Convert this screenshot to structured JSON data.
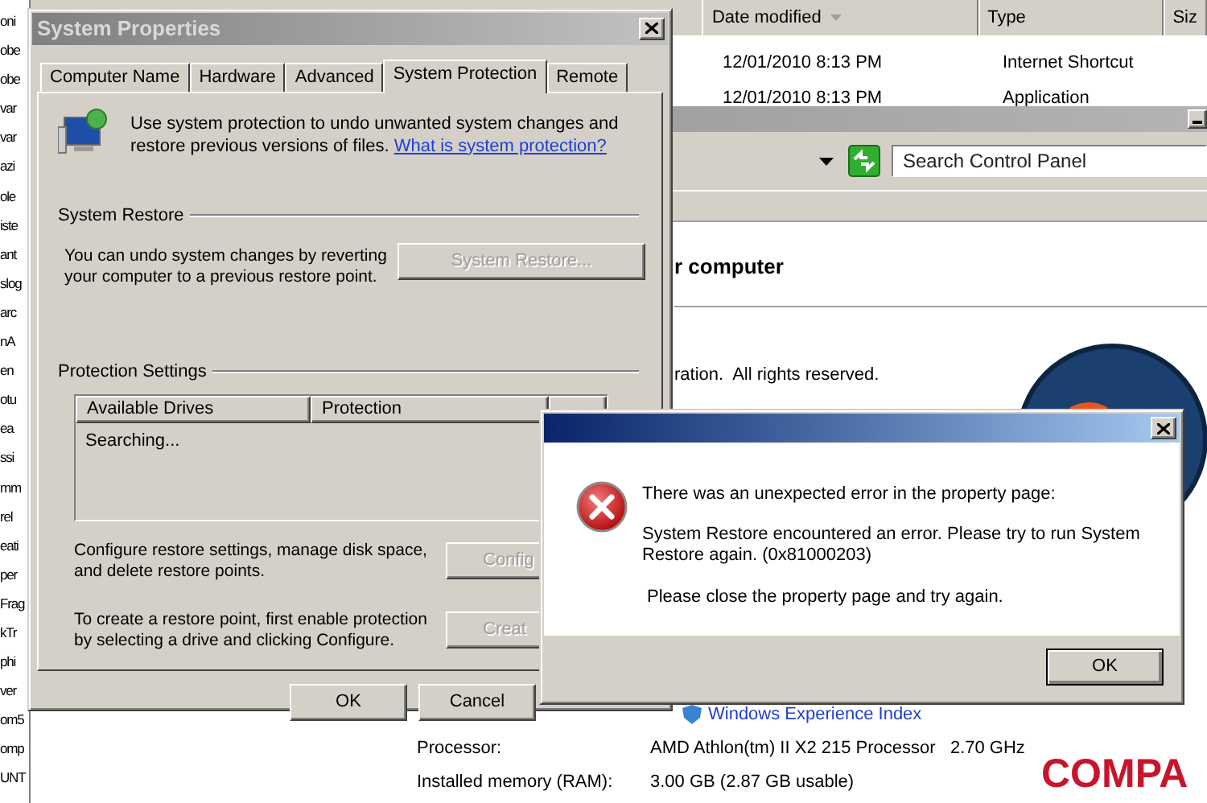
{
  "file_list": {
    "names": [
      "oni",
      "obe",
      "obe",
      "var",
      "var",
      "azi",
      "ole",
      "iste",
      "ant",
      "slog",
      "arc",
      "nA",
      "en",
      "otu",
      "ea",
      "ssi",
      "mm",
      "rel",
      "eati",
      "per",
      "Frag",
      "kTr",
      "phi",
      "ver",
      "om5",
      "omp",
      "UNT"
    ]
  },
  "explorer": {
    "columns": [
      {
        "label": "Date modified",
        "sorted": true
      },
      {
        "label": "Type",
        "sorted": false
      },
      {
        "label": "Siz",
        "sorted": false
      }
    ],
    "rows": [
      {
        "date": "12/01/2010 8:13 PM",
        "type": "Internet Shortcut"
      },
      {
        "date": "12/01/2010 8:13 PM",
        "type": "Application"
      }
    ]
  },
  "control_panel": {
    "search": {
      "placeholder": "Search Control Panel"
    },
    "heading": "r computer",
    "copyright": "ration.  All rights reserved.",
    "link": "Windows Experience Index",
    "specs": [
      {
        "label": "Processor:",
        "value": "AMD Athlon(tm) II X2 215 Processor   2.70 GHz"
      },
      {
        "label": "Installed memory (RAM):",
        "value": "3.00 GB (2.87 GB usable)"
      }
    ],
    "logo_text": "COMPA"
  },
  "system_properties": {
    "title": "System Properties",
    "tabs": [
      {
        "label": "Computer Name",
        "selected": false
      },
      {
        "label": "Hardware",
        "selected": false
      },
      {
        "label": "Advanced",
        "selected": false
      },
      {
        "label": "System Protection",
        "selected": true
      },
      {
        "label": "Remote",
        "selected": false
      }
    ],
    "intro": "Use system protection to undo unwanted system changes and restore previous versions of files.",
    "intro_link": "What is system protection?",
    "restore": {
      "title": "System Restore",
      "text": "You can undo system changes by reverting your computer to a previous restore point.",
      "button": {
        "label": "System Restore...",
        "disabled": true
      }
    },
    "protection": {
      "title": "Protection Settings",
      "columns": [
        "Available Drives",
        "Protection"
      ],
      "status": "Searching...",
      "actions": [
        {
          "text": "Configure restore settings, manage disk space, and delete restore points.",
          "button": {
            "label": "Config",
            "disabled": true
          }
        },
        {
          "text": "To create a restore point, first enable protection by selecting a drive and clicking Configure.",
          "button": {
            "label": "Creat",
            "disabled": true
          }
        }
      ]
    },
    "buttons": [
      {
        "label": "OK"
      },
      {
        "label": "Cancel"
      }
    ]
  },
  "error_dialog": {
    "messages": [
      "There was an unexpected error in the property page:",
      "System Restore encountered an error. Please try to run System Restore again. (0x81000203)",
      "Please close the property page and try again."
    ],
    "button": "OK"
  }
}
